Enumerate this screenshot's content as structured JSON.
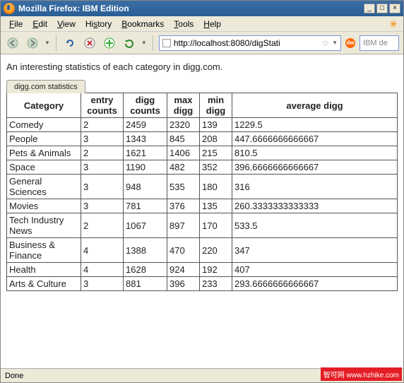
{
  "window": {
    "title": "Mozilla Firefox: IBM Edition"
  },
  "menubar": {
    "file": "File",
    "edit": "Edit",
    "view": "View",
    "history": "History",
    "bookmarks": "Bookmarks",
    "tools": "Tools",
    "help": "Help"
  },
  "toolbar": {
    "url": "http://localhost:8080/digStati",
    "search_placeholder": "IBM de"
  },
  "page": {
    "heading": "An interesting statistics of each category in digg.com.",
    "tab_label": "digg.com statistics",
    "columns": {
      "category": "Category",
      "entry": "entry counts",
      "digg": "digg counts",
      "max": "max digg",
      "min": "min digg",
      "avg": "average digg"
    },
    "rows": [
      {
        "cat": "Comedy",
        "entry": "2",
        "digg": "2459",
        "max": "2320",
        "min": "139",
        "avg": "1229.5"
      },
      {
        "cat": "People",
        "entry": "3",
        "digg": "1343",
        "max": "845",
        "min": "208",
        "avg": "447.6666666666667"
      },
      {
        "cat": "Pets & Animals",
        "entry": "2",
        "digg": "1621",
        "max": "1406",
        "min": "215",
        "avg": "810.5"
      },
      {
        "cat": "Space",
        "entry": "3",
        "digg": "1190",
        "max": "482",
        "min": "352",
        "avg": "396.6666666666667"
      },
      {
        "cat": "General Sciences",
        "entry": "3",
        "digg": "948",
        "max": "535",
        "min": "180",
        "avg": "316"
      },
      {
        "cat": "Movies",
        "entry": "3",
        "digg": "781",
        "max": "376",
        "min": "135",
        "avg": "260.3333333333333"
      },
      {
        "cat": "Tech Industry News",
        "entry": "2",
        "digg": "1067",
        "max": "897",
        "min": "170",
        "avg": "533.5"
      },
      {
        "cat": "Business & Finance",
        "entry": "4",
        "digg": "1388",
        "max": "470",
        "min": "220",
        "avg": "347"
      },
      {
        "cat": "Health",
        "entry": "4",
        "digg": "1628",
        "max": "924",
        "min": "192",
        "avg": "407"
      },
      {
        "cat": "Arts & Culture",
        "entry": "3",
        "digg": "881",
        "max": "396",
        "min": "233",
        "avg": "293.6666666666667"
      }
    ]
  },
  "statusbar": {
    "text": "Done"
  },
  "watermark": {
    "cn": "智可网",
    "url": "www.hzhike.com"
  }
}
